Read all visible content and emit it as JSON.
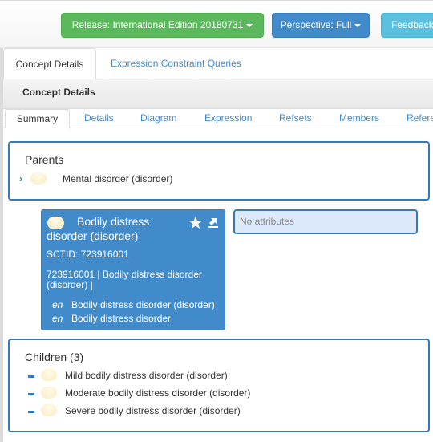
{
  "toolbar": {
    "release_label": "Release: International Edition 20180731",
    "perspective_label": "Perspective: Full",
    "feedback_label": "Feedback",
    "colors": {
      "release": "#5cb85c",
      "perspective": "#428bca",
      "feedback": "#5bc0de"
    }
  },
  "main_tabs": [
    {
      "label": "Concept Details",
      "active": true
    },
    {
      "label": "Expression Constraint Queries",
      "active": false
    }
  ],
  "panel": {
    "heading": "Concept Details",
    "tabs": [
      {
        "label": "Summary",
        "active": true
      },
      {
        "label": "Details"
      },
      {
        "label": "Diagram"
      },
      {
        "label": "Expression"
      },
      {
        "label": "Refsets"
      },
      {
        "label": "Members"
      },
      {
        "label": "References"
      }
    ]
  },
  "parents": {
    "title": "Parents",
    "items": [
      {
        "label": "Mental disorder (disorder)",
        "icon": "chevron-right-icon"
      }
    ]
  },
  "concept": {
    "title": "Bodily distress disorder (disorder)",
    "sctid_label": "SCTID: 723916001",
    "fsn_expression": "723916001 | Bodily distress disorder (disorder) |",
    "descriptions": [
      {
        "lang": "en",
        "term": "Bodily distress disorder (disorder)"
      },
      {
        "lang": "en",
        "term": "Bodily distress disorder"
      }
    ],
    "accent_color": "#428bca"
  },
  "attributes": {
    "empty_text": "No attributes"
  },
  "children": {
    "title": "Children (3)",
    "items": [
      {
        "label": "Mild bodily distress disorder (disorder)"
      },
      {
        "label": "Moderate bodily distress disorder (disorder)"
      },
      {
        "label": "Severe bodily distress disorder (disorder)"
      }
    ]
  }
}
